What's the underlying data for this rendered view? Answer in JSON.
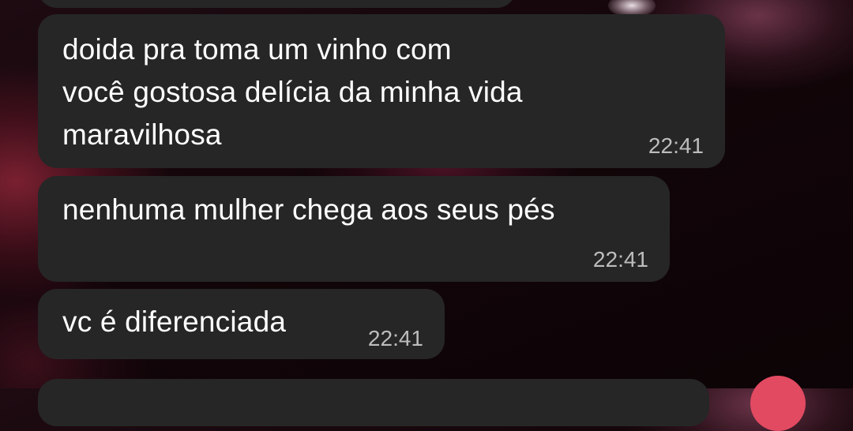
{
  "messages": [
    {
      "text": "doida pra toma um vinho com\nvocê gostosa delícia da minha vida\nmaravilhosa",
      "time": "22:41"
    },
    {
      "text": "nenhuma mulher chega aos seus pés",
      "time": "22:41"
    },
    {
      "text": "vc é diferenciada",
      "time": "22:41"
    }
  ],
  "colors": {
    "bubble": "#262626",
    "text": "#ffffff",
    "time": "#bdbdbd",
    "accent": "#e24a62"
  }
}
